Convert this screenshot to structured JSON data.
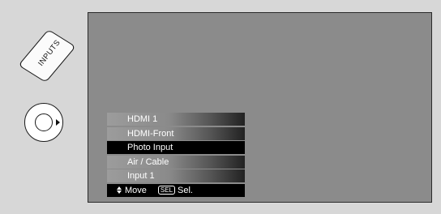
{
  "remote": {
    "inputs_label": "INPUTS"
  },
  "menu": {
    "items": [
      {
        "label": "HDMI 1"
      },
      {
        "label": "HDMI-Front"
      },
      {
        "label": "Photo Input"
      },
      {
        "label": "Air / Cable"
      },
      {
        "label": "Input 1"
      }
    ],
    "selected": "Photo Input",
    "footer": {
      "move_label": "Move",
      "sel_key": "SEL",
      "sel_label": "Sel."
    }
  },
  "colors": {
    "screen": "#8b8b8b",
    "selected_item": "#000000",
    "background": "#d7d7d7"
  }
}
